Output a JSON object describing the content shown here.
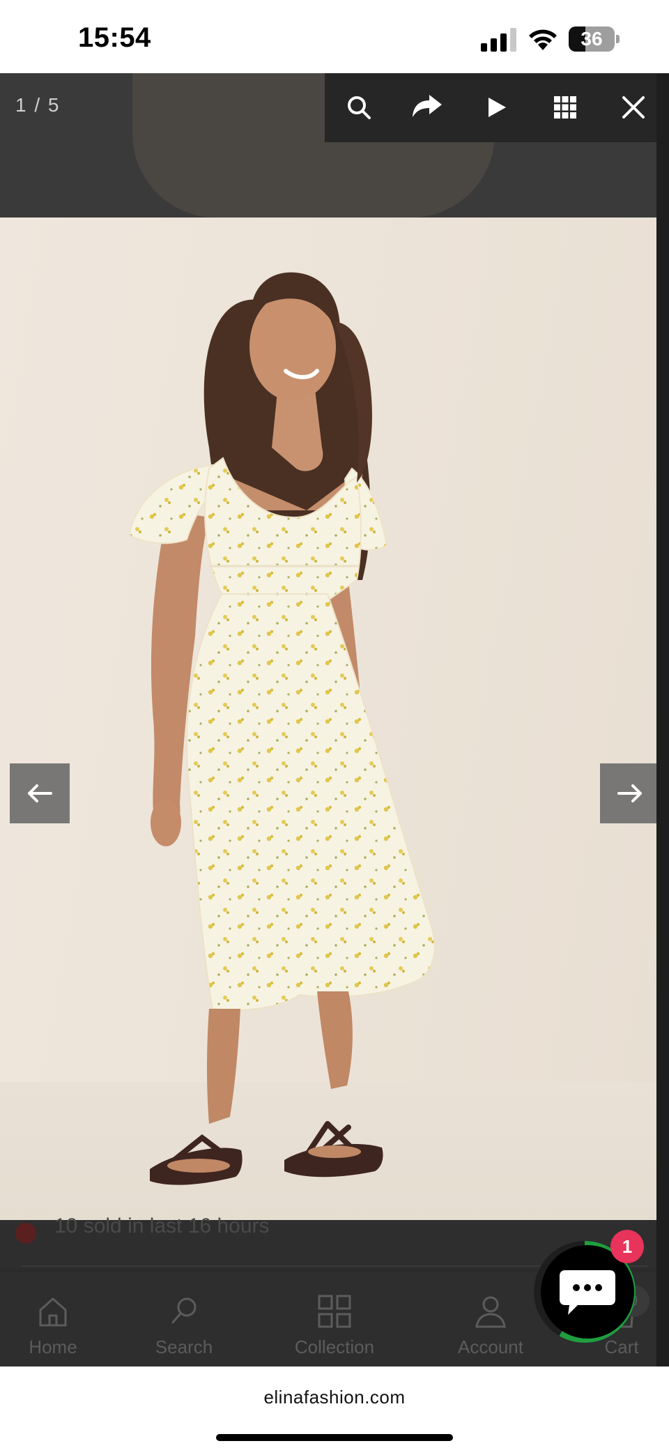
{
  "status_bar": {
    "time": "15:54",
    "battery_level": "36",
    "battery_fraction": 0.36,
    "signal_bars": 3
  },
  "lightbox": {
    "counter": "1 / 5",
    "tools": [
      "search-icon",
      "share-icon",
      "play-icon",
      "grid-icon",
      "close-icon"
    ],
    "prev_icon": "arrow-left-icon",
    "next_icon": "arrow-right-icon"
  },
  "page_behind": {
    "sold_text": "10 sold in last 16 hours"
  },
  "bottom_nav": {
    "items": [
      {
        "label": "Home",
        "icon": "home-icon"
      },
      {
        "label": "Search",
        "icon": "search-icon"
      },
      {
        "label": "Collection",
        "icon": "grid-icon"
      },
      {
        "label": "Account",
        "icon": "user-icon"
      },
      {
        "label": "Cart",
        "icon": "bag-icon"
      }
    ],
    "cart_count": "0"
  },
  "chat": {
    "badge_count": "1",
    "ring_color": "#1e9e3e",
    "badge_color": "#e8335a"
  },
  "browser": {
    "url": "elinafashion.com"
  }
}
